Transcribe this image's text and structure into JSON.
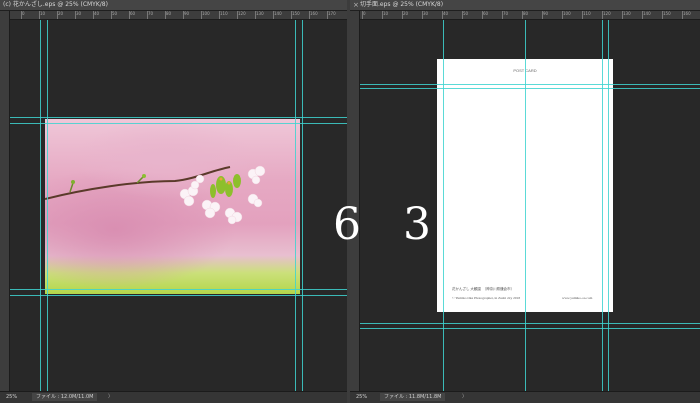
{
  "left_document": {
    "tab_close": "",
    "title": "(c) 花かんざし.eps @ 25% (CMYK/8)",
    "ruler_ticks": [
      "0",
      "10",
      "20",
      "30",
      "40",
      "50",
      "60",
      "70",
      "80",
      "90",
      "100",
      "110",
      "120",
      "130",
      "140",
      "150",
      "160",
      "170"
    ],
    "zoom": "25%",
    "file_info": "ファイル : 12.0M/11.0M",
    "arrow": "〉"
  },
  "right_document": {
    "tab_close": "×",
    "title": "切手面.eps @ 25% (CMYK/8)",
    "ruler_ticks": [
      "0",
      "10",
      "20",
      "30",
      "40",
      "50",
      "60",
      "70",
      "80",
      "90",
      "100",
      "110",
      "120",
      "130",
      "140",
      "150",
      "160",
      "170"
    ],
    "zoom": "25%",
    "file_info": "ファイル : 11.8M/11.8M",
    "arrow": "〉",
    "postcard": {
      "title": "POST CARD",
      "caption": "花かんざし 大観園　（神奈川県鎌倉市）",
      "credit": "© Yumiko Oka Photographer, in Zushi city 2018",
      "url": "www.yumiko-oa.com"
    }
  },
  "overlay_number": "6 3",
  "colors": {
    "guide": "#3ed3d0",
    "canvas": "#282828",
    "window": "#262626",
    "titlebar": "#454545"
  }
}
